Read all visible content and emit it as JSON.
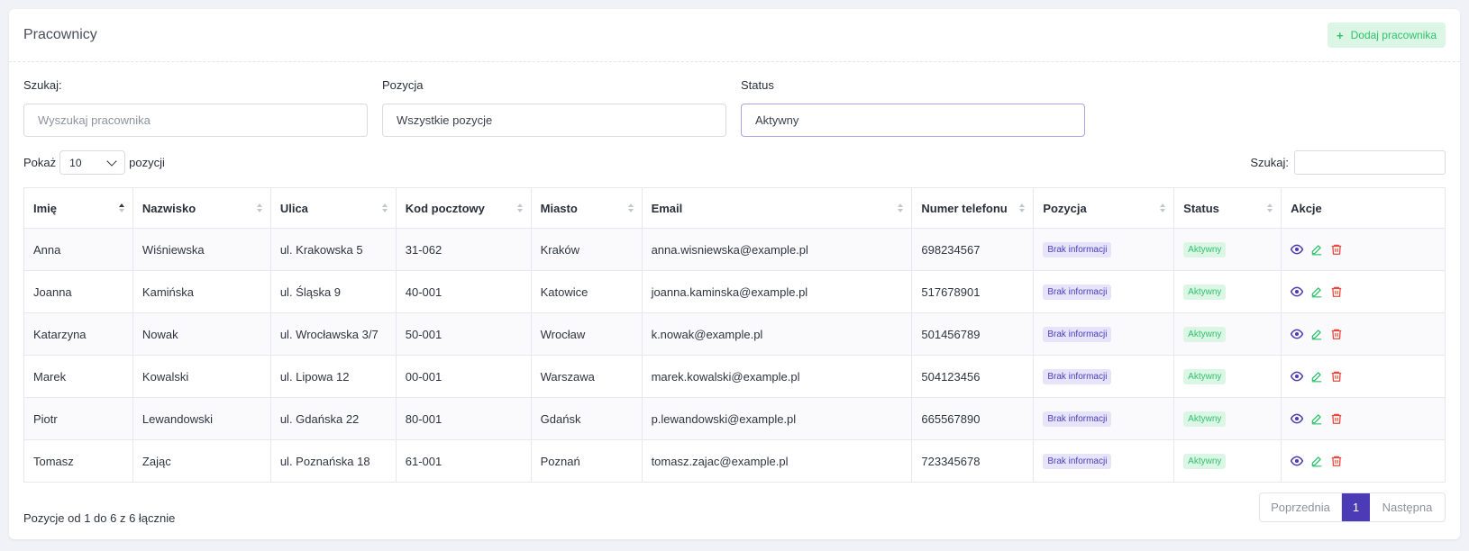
{
  "header": {
    "title": "Pracownicy",
    "add_button": "Dodaj pracownika",
    "add_icon": "+"
  },
  "filters": [
    {
      "label": "Szukaj:",
      "placeholder": "Wyszukaj pracownika"
    },
    {
      "label": "Pozycja",
      "value": "Wszystkie pozycje"
    },
    {
      "label": "Status",
      "value": "Aktywny"
    }
  ],
  "length": {
    "prefix": "Pokaż",
    "value": "10",
    "suffix": "pozycji"
  },
  "table_search_label": "Szukaj:",
  "columns": [
    "Imię",
    "Nazwisko",
    "Ulica",
    "Kod pocztowy",
    "Miasto",
    "Email",
    "Numer telefonu",
    "Pozycja",
    "Status",
    "Akcje"
  ],
  "rows": [
    [
      "Anna",
      "Wiśniewska",
      "ul. Krakowska 5",
      "31-062",
      "Kraków",
      "anna.wisniewska@example.pl",
      "698234567",
      "Brak informacji",
      "Aktywny"
    ],
    [
      "Joanna",
      "Kamińska",
      "ul. Śląska 9",
      "40-001",
      "Katowice",
      "joanna.kaminska@example.pl",
      "517678901",
      "Brak informacji",
      "Aktywny"
    ],
    [
      "Katarzyna",
      "Nowak",
      "ul. Wrocławska 3/7",
      "50-001",
      "Wrocław",
      "k.nowak@example.pl",
      "501456789",
      "Brak informacji",
      "Aktywny"
    ],
    [
      "Marek",
      "Kowalski",
      "ul. Lipowa 12",
      "00-001",
      "Warszawa",
      "marek.kowalski@example.pl",
      "504123456",
      "Brak informacji",
      "Aktywny"
    ],
    [
      "Piotr",
      "Lewandowski",
      "ul. Gdańska 22",
      "80-001",
      "Gdańsk",
      "p.lewandowski@example.pl",
      "665567890",
      "Brak informacji",
      "Aktywny"
    ],
    [
      "Tomasz",
      "Zając",
      "ul. Poznańska 18",
      "61-001",
      "Poznań",
      "tomasz.zajac@example.pl",
      "723345678",
      "Brak informacji",
      "Aktywny"
    ]
  ],
  "footer": {
    "info": "Pozycje od 1 do 6 z 6 łącznie",
    "prev": "Poprzednia",
    "page": "1",
    "next": "Następna"
  },
  "colors": {
    "accent": "#4b3bb5",
    "success": "#2fc26c",
    "danger": "#e8473b"
  }
}
